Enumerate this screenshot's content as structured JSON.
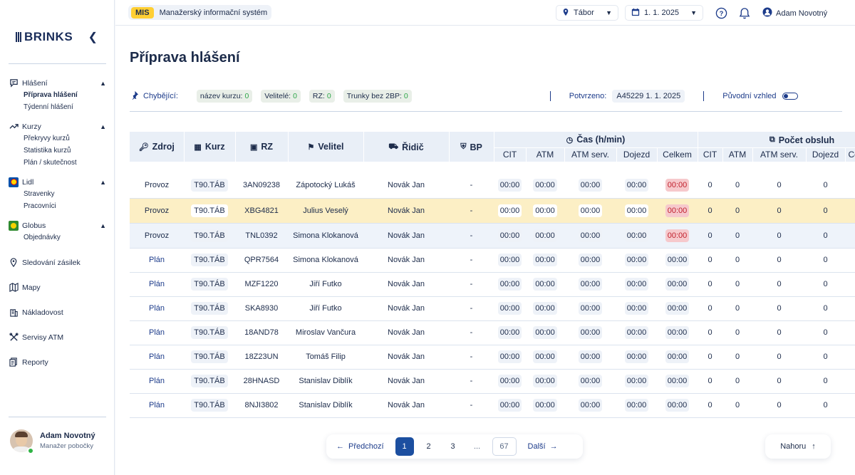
{
  "sidebar": {
    "logo_text": "BRINKS",
    "nav": {
      "hlaseni": {
        "label": "Hlášení",
        "items": [
          "Příprava hlášení",
          "Týdenní hlášení"
        ]
      },
      "kurzy": {
        "label": "Kurzy",
        "items": [
          "Překryvy kurzů",
          "Statistika kurzů",
          "Plán / skutečnost"
        ]
      },
      "lidl": {
        "label": "Lidl",
        "items": [
          "Stravenky",
          "Pracovníci"
        ]
      },
      "globus": {
        "label": "Globus",
        "items": [
          "Objednávky"
        ]
      },
      "sledovani": "Sledování zásilek",
      "mapy": "Mapy",
      "nakladovost": "Nákladovost",
      "servisy": "Servisy ATM",
      "reporty": "Reporty"
    },
    "user": {
      "name": "Adam Novotný",
      "role": "Manažer pobočky"
    }
  },
  "topbar": {
    "badge": "MIS",
    "app_title": "Manažerský informační systém",
    "location": "Tábor",
    "date": "1. 1. 2025",
    "user_name": "Adam Novotný"
  },
  "page": {
    "title": "Příprava hlášení",
    "missing_label": "Chybějící:",
    "chips": [
      {
        "label": "název kurzu:",
        "count": "0"
      },
      {
        "label": "Velitelé:",
        "count": "0"
      },
      {
        "label": "RZ:",
        "count": "0"
      },
      {
        "label": "Trunky bez 2BP:",
        "count": "0"
      }
    ],
    "confirmed_label": "Potvrzeno:",
    "confirmed_value": "A45229 1. 1. 2025",
    "original_view_label": "Původní vzhled"
  },
  "table": {
    "headers": {
      "zdroj": "Zdroj",
      "kurz": "Kurz",
      "rz": "RZ",
      "velitel": "Velitel",
      "ridic": "Řidič",
      "bp": "BP",
      "cas_group": "Čas (h/min)",
      "pocet_group": "Počet obsluh",
      "cas_sub": [
        "CIT",
        "ATM",
        "ATM serv.",
        "Dojezd",
        "Celkem"
      ],
      "pocet_sub": [
        "CIT",
        "ATM",
        "ATM serv.",
        "Dojezd",
        "Ce"
      ]
    },
    "rows": [
      {
        "zdroj": "Provoz",
        "kurz": "T90.TÁB",
        "rz": "3AN09238",
        "velitel": "Zápotocký Lukáš",
        "ridic": "Novák Jan",
        "bp": "-",
        "cas": [
          "00:00",
          "00:00",
          "00:00",
          "00:00",
          "00:00"
        ],
        "pocet": [
          "0",
          "0",
          "0",
          "0"
        ]
      },
      {
        "zdroj": "Provoz",
        "kurz": "T90.TÁB",
        "rz": "XBG4821",
        "velitel": "Julius Veselý",
        "ridic": "Novák Jan",
        "bp": "-",
        "cas": [
          "00:00",
          "00:00",
          "00:00",
          "00:00",
          "00:00"
        ],
        "pocet": [
          "0",
          "0",
          "0",
          "0"
        ]
      },
      {
        "zdroj": "Provoz",
        "kurz": "T90.TÁB",
        "rz": "TNL0392",
        "velitel": "Simona Klokanová",
        "ridic": "Novák Jan",
        "bp": "-",
        "cas": [
          "00:00",
          "00:00",
          "00:00",
          "00:00",
          "00:00"
        ],
        "pocet": [
          "0",
          "0",
          "0",
          "0"
        ]
      },
      {
        "zdroj": "Plán",
        "kurz": "T90.TÁB",
        "rz": "QPR7564",
        "velitel": "Simona Klokanová",
        "ridic": "Novák Jan",
        "bp": "-",
        "cas": [
          "00:00",
          "00:00",
          "00:00",
          "00:00",
          "00:00"
        ],
        "pocet": [
          "0",
          "0",
          "0",
          "0"
        ]
      },
      {
        "zdroj": "Plán",
        "kurz": "T90.TÁB",
        "rz": "MZF1220",
        "velitel": "Jiří Futko",
        "ridic": "Novák Jan",
        "bp": "-",
        "cas": [
          "00:00",
          "00:00",
          "00:00",
          "00:00",
          "00:00"
        ],
        "pocet": [
          "0",
          "0",
          "0",
          "0"
        ]
      },
      {
        "zdroj": "Plán",
        "kurz": "T90.TÁB",
        "rz": "SKA8930",
        "velitel": "Jiří Futko",
        "ridic": "Novák Jan",
        "bp": "-",
        "cas": [
          "00:00",
          "00:00",
          "00:00",
          "00:00",
          "00:00"
        ],
        "pocet": [
          "0",
          "0",
          "0",
          "0"
        ]
      },
      {
        "zdroj": "Plán",
        "kurz": "T90.TÁB",
        "rz": "18AND78",
        "velitel": "Miroslav Vančura",
        "ridic": "Novák Jan",
        "bp": "-",
        "cas": [
          "00:00",
          "00:00",
          "00:00",
          "00:00",
          "00:00"
        ],
        "pocet": [
          "0",
          "0",
          "0",
          "0"
        ]
      },
      {
        "zdroj": "Plán",
        "kurz": "T90.TÁB",
        "rz": "18Z23UN",
        "velitel": "Tomáš Filip",
        "ridic": "Novák Jan",
        "bp": "-",
        "cas": [
          "00:00",
          "00:00",
          "00:00",
          "00:00",
          "00:00"
        ],
        "pocet": [
          "0",
          "0",
          "0",
          "0"
        ]
      },
      {
        "zdroj": "Plán",
        "kurz": "T90.TÁB",
        "rz": "28HNASD",
        "velitel": "Stanislav Diblík",
        "ridic": "Novák Jan",
        "bp": "-",
        "cas": [
          "00:00",
          "00:00",
          "00:00",
          "00:00",
          "00:00"
        ],
        "pocet": [
          "0",
          "0",
          "0",
          "0"
        ]
      },
      {
        "zdroj": "Plán",
        "kurz": "T90.TÁB",
        "rz": "8NJI3802",
        "velitel": "Stanislav Diblík",
        "ridic": "Novák Jan",
        "bp": "-",
        "cas": [
          "00:00",
          "00:00",
          "00:00",
          "00:00",
          "00:00"
        ],
        "pocet": [
          "0",
          "0",
          "0",
          "0"
        ]
      }
    ]
  },
  "pagination": {
    "prev_label": "Předchozí",
    "next_label": "Další",
    "pages": [
      "1",
      "2",
      "3"
    ],
    "ellipsis": "...",
    "last_page": "67",
    "current": "1"
  },
  "back_to_top_label": "Nahoru",
  "colors": {
    "accent": "#1c4fa0",
    "highlight_row": "#fcefc5",
    "selected_row": "#eef3fa",
    "total_red": "#f6c9cc",
    "mis_badge": "#ffcf33"
  }
}
